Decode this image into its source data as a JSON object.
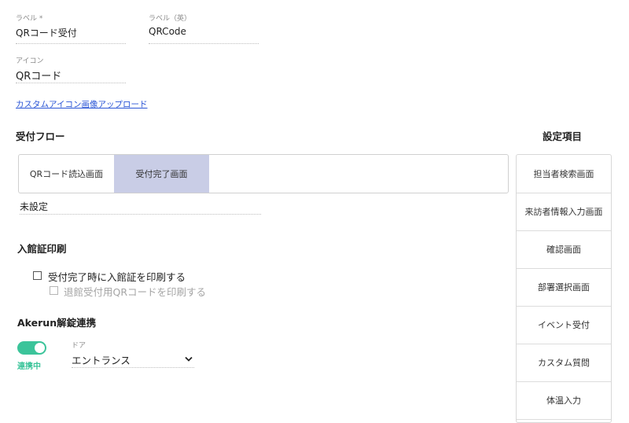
{
  "label_field": {
    "label": "ラベル *",
    "value": "QRコード受付"
  },
  "label_en_field": {
    "label": "ラベル（英）",
    "value": "QRCode"
  },
  "icon_field": {
    "label": "アイコン",
    "value": "QRコード"
  },
  "custom_icon_link": "カスタムアイコン画像アップロード",
  "flow": {
    "title": "受付フロー",
    "tabs": [
      {
        "label": "QRコード読込画面",
        "active": false
      },
      {
        "label": "受付完了画面",
        "active": true
      }
    ],
    "unset_value": "未設定"
  },
  "badge_print": {
    "title": "入館証印刷",
    "option1": "受付完了時に入館証を印刷する",
    "option2": "退館受付用QRコードを印刷する"
  },
  "akerun": {
    "title": "Akerun解錠連携",
    "toggle_status": "連携中",
    "door_label": "ドア",
    "door_value": "エントランス"
  },
  "settings": {
    "title": "設定項目",
    "items": [
      "担当者検索画面",
      "来訪者情報入力画面",
      "確認画面",
      "部署選択画面",
      "イベント受付",
      "カスタム質問",
      "体温入力"
    ]
  },
  "colors": {
    "toggle_on": "#3bc49a",
    "active_tab": "#c9cde6",
    "link": "#2a55d6"
  },
  "icons": {
    "dropdown": "chevron-down-icon"
  }
}
